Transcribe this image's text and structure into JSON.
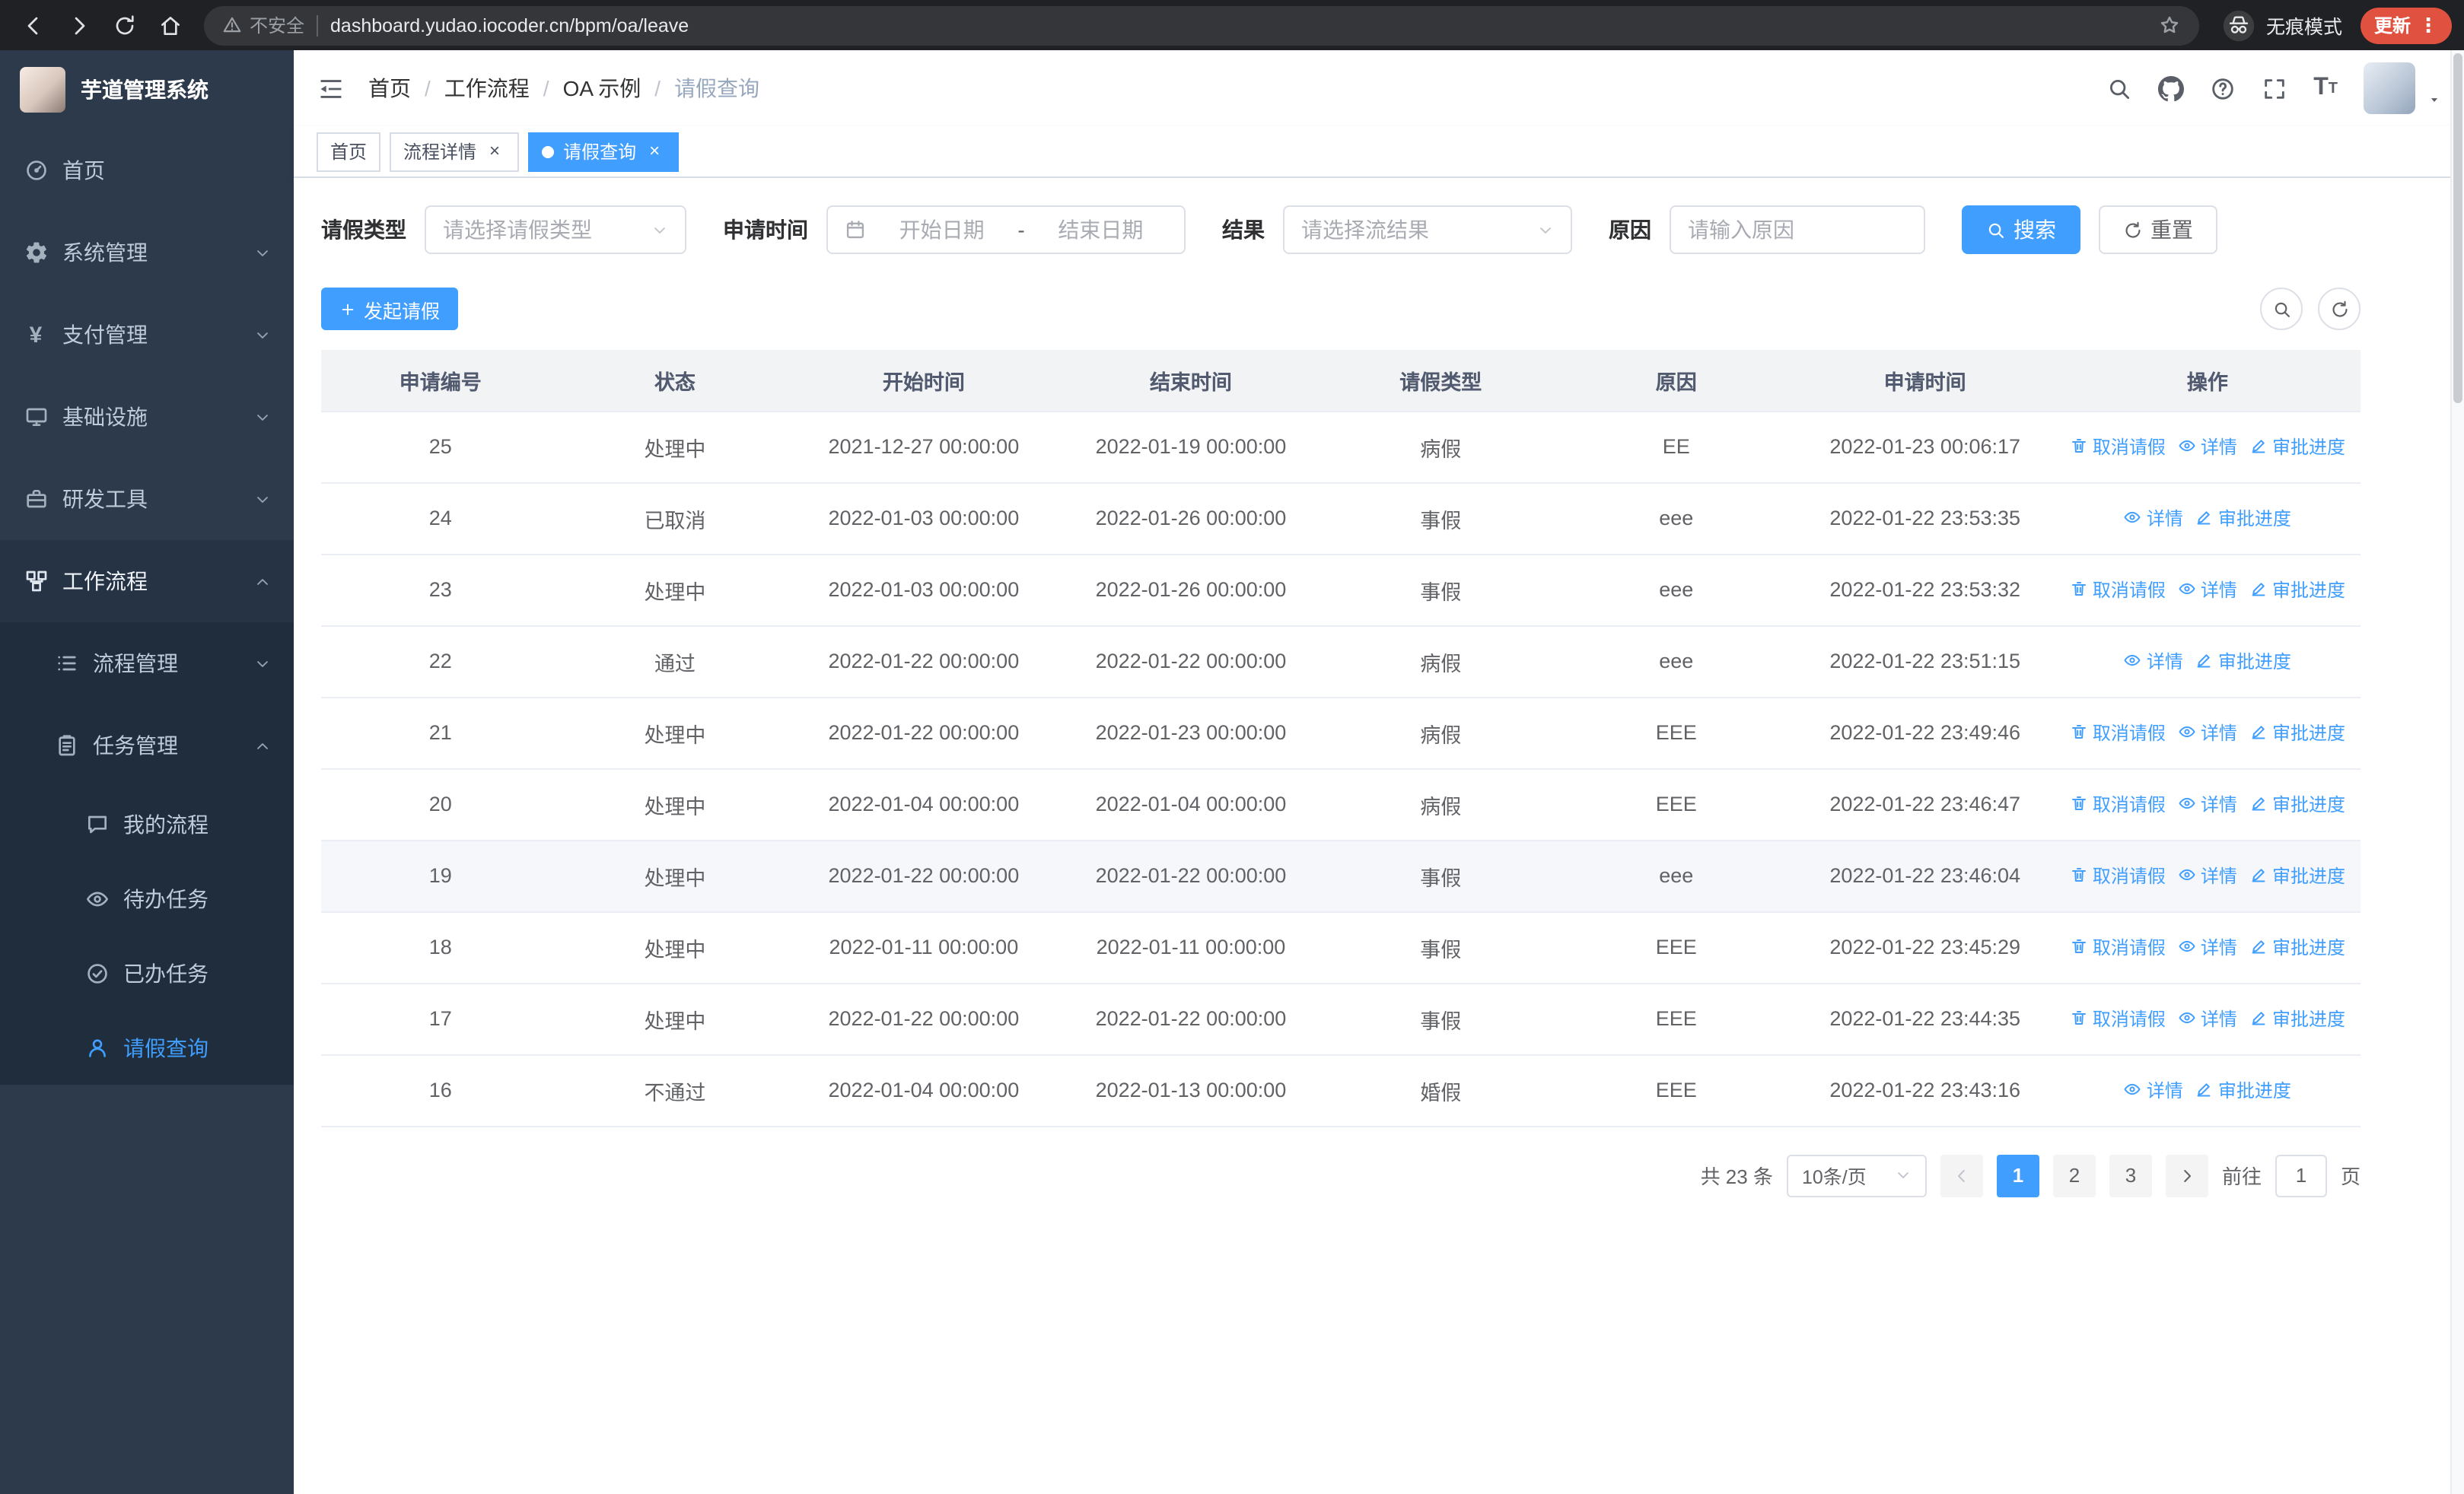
{
  "colors": {
    "accent": "#409eff",
    "chrome_bg": "#202124",
    "urlbar_bg": "#35363a",
    "update_red": "#e0523f",
    "sidebar_bg": "#2d3a4b",
    "submenu_bg": "#1f2d3d",
    "trail_bg": "#263344"
  },
  "browser": {
    "security_warning": "不安全",
    "url": "dashboard.yudao.iocoder.cn/bpm/oa/leave",
    "incognito_label": "无痕模式",
    "update_label": "更新",
    "nav": [
      {
        "key": "back",
        "icon": "back-icon"
      },
      {
        "key": "forward",
        "icon": "forward-icon"
      },
      {
        "key": "reload",
        "icon": "reload-icon"
      },
      {
        "key": "home",
        "icon": "home-icon"
      }
    ]
  },
  "sidebar": {
    "logo_title": "芋道管理系统",
    "items": [
      {
        "key": "home",
        "label": "首页",
        "icon": "dashboard-icon",
        "level": 1
      },
      {
        "key": "system",
        "label": "系统管理",
        "icon": "gear-icon",
        "level": 1,
        "arrow": "down"
      },
      {
        "key": "payment",
        "label": "支付管理",
        "icon": "yen-icon",
        "level": 1,
        "arrow": "down"
      },
      {
        "key": "infrastructure",
        "label": "基础设施",
        "icon": "infra-icon",
        "level": 1,
        "arrow": "down"
      },
      {
        "key": "dev-tools",
        "label": "研发工具",
        "icon": "toolbox-icon",
        "level": 1,
        "arrow": "down"
      },
      {
        "key": "workflow",
        "label": "工作流程",
        "icon": "workflow-icon",
        "level": 1,
        "arrow": "up",
        "trail": true
      },
      {
        "key": "process-mgmt",
        "label": "流程管理",
        "icon": "list-icon",
        "level": 2,
        "arrow": "down"
      },
      {
        "key": "task-mgmt",
        "label": "任务管理",
        "icon": "clipboard-icon",
        "level": 2,
        "arrow": "up"
      },
      {
        "key": "my-process",
        "label": "我的流程",
        "icon": "chat-icon",
        "level": 3
      },
      {
        "key": "todo-tasks",
        "label": "待办任务",
        "icon": "view-icon",
        "level": 3
      },
      {
        "key": "done-tasks",
        "label": "已办任务",
        "icon": "check-circle-icon",
        "level": 3
      },
      {
        "key": "leave-query",
        "label": "请假查询",
        "icon": "user-icon",
        "level": 3,
        "active": true
      }
    ]
  },
  "header": {
    "breadcrumb": [
      "首页",
      "工作流程",
      "OA 示例",
      "请假查询"
    ],
    "breadcrumb_separator": "/",
    "tools": [
      {
        "key": "search",
        "icon": "search-icon"
      },
      {
        "key": "github",
        "icon": "github-icon"
      },
      {
        "key": "help",
        "icon": "question-icon"
      },
      {
        "key": "fullscreen",
        "icon": "fullscreen-icon"
      },
      {
        "key": "font-size",
        "icon": "fontsize-icon"
      }
    ]
  },
  "tabs": [
    {
      "key": "home",
      "label": "首页",
      "closable": false
    },
    {
      "key": "process-detail",
      "label": "流程详情",
      "closable": true
    },
    {
      "key": "leave-query",
      "label": "请假查询",
      "closable": true,
      "active": true
    }
  ],
  "filters": {
    "leave_type_label": "请假类型",
    "leave_type_placeholder": "请选择请假类型",
    "apply_time_label": "申请时间",
    "date_start_placeholder": "开始日期",
    "date_separator": "-",
    "date_end_placeholder": "结束日期",
    "result_label": "结果",
    "result_placeholder": "请选择流结果",
    "reason_label": "原因",
    "reason_placeholder": "请输入原因",
    "search_button": "搜索",
    "reset_button": "重置"
  },
  "toolbar": {
    "create_button": "发起请假",
    "tools": [
      {
        "key": "toggle-search",
        "icon": "search-icon"
      },
      {
        "key": "refresh",
        "icon": "refresh-icon"
      }
    ]
  },
  "table": {
    "columns": [
      "申请编号",
      "状态",
      "开始时间",
      "结束时间",
      "请假类型",
      "原因",
      "申请时间",
      "操作"
    ],
    "action_defs": {
      "cancel": {
        "label": "取消请假",
        "icon": "delete-icon"
      },
      "detail": {
        "label": "详情",
        "icon": "view-icon"
      },
      "progress": {
        "label": "审批进度",
        "icon": "edit-icon"
      }
    },
    "rows": [
      {
        "id": "25",
        "status": "处理中",
        "start": "2021-12-27 00:00:00",
        "end": "2022-01-19 00:00:00",
        "type": "病假",
        "reason": "EE",
        "apply_time": "2022-01-23 00:06:17",
        "actions": [
          "cancel",
          "detail",
          "progress"
        ]
      },
      {
        "id": "24",
        "status": "已取消",
        "start": "2022-01-03 00:00:00",
        "end": "2022-01-26 00:00:00",
        "type": "事假",
        "reason": "eee",
        "apply_time": "2022-01-22 23:53:35",
        "actions": [
          "detail",
          "progress"
        ]
      },
      {
        "id": "23",
        "status": "处理中",
        "start": "2022-01-03 00:00:00",
        "end": "2022-01-26 00:00:00",
        "type": "事假",
        "reason": "eee",
        "apply_time": "2022-01-22 23:53:32",
        "actions": [
          "cancel",
          "detail",
          "progress"
        ]
      },
      {
        "id": "22",
        "status": "通过",
        "start": "2022-01-22 00:00:00",
        "end": "2022-01-22 00:00:00",
        "type": "病假",
        "reason": "eee",
        "apply_time": "2022-01-22 23:51:15",
        "actions": [
          "detail",
          "progress"
        ]
      },
      {
        "id": "21",
        "status": "处理中",
        "start": "2022-01-22 00:00:00",
        "end": "2022-01-23 00:00:00",
        "type": "病假",
        "reason": "EEE",
        "apply_time": "2022-01-22 23:49:46",
        "actions": [
          "cancel",
          "detail",
          "progress"
        ]
      },
      {
        "id": "20",
        "status": "处理中",
        "start": "2022-01-04 00:00:00",
        "end": "2022-01-04 00:00:00",
        "type": "病假",
        "reason": "EEE",
        "apply_time": "2022-01-22 23:46:47",
        "actions": [
          "cancel",
          "detail",
          "progress"
        ]
      },
      {
        "id": "19",
        "status": "处理中",
        "start": "2022-01-22 00:00:00",
        "end": "2022-01-22 00:00:00",
        "type": "事假",
        "reason": "eee",
        "apply_time": "2022-01-22 23:46:04",
        "actions": [
          "cancel",
          "detail",
          "progress"
        ],
        "highlighted": true
      },
      {
        "id": "18",
        "status": "处理中",
        "start": "2022-01-11 00:00:00",
        "end": "2022-01-11 00:00:00",
        "type": "事假",
        "reason": "EEE",
        "apply_time": "2022-01-22 23:45:29",
        "actions": [
          "cancel",
          "detail",
          "progress"
        ]
      },
      {
        "id": "17",
        "status": "处理中",
        "start": "2022-01-22 00:00:00",
        "end": "2022-01-22 00:00:00",
        "type": "事假",
        "reason": "EEE",
        "apply_time": "2022-01-22 23:44:35",
        "actions": [
          "cancel",
          "detail",
          "progress"
        ]
      },
      {
        "id": "16",
        "status": "不通过",
        "start": "2022-01-04 00:00:00",
        "end": "2022-01-13 00:00:00",
        "type": "婚假",
        "reason": "EEE",
        "apply_time": "2022-01-22 23:43:16",
        "actions": [
          "detail",
          "progress"
        ]
      }
    ]
  },
  "pagination": {
    "total": "共 23 条",
    "page_size": "10条/页",
    "pages": [
      "1",
      "2",
      "3"
    ],
    "active_page": "1",
    "goto_label": "前往",
    "goto_value": "1",
    "unit": "页"
  }
}
